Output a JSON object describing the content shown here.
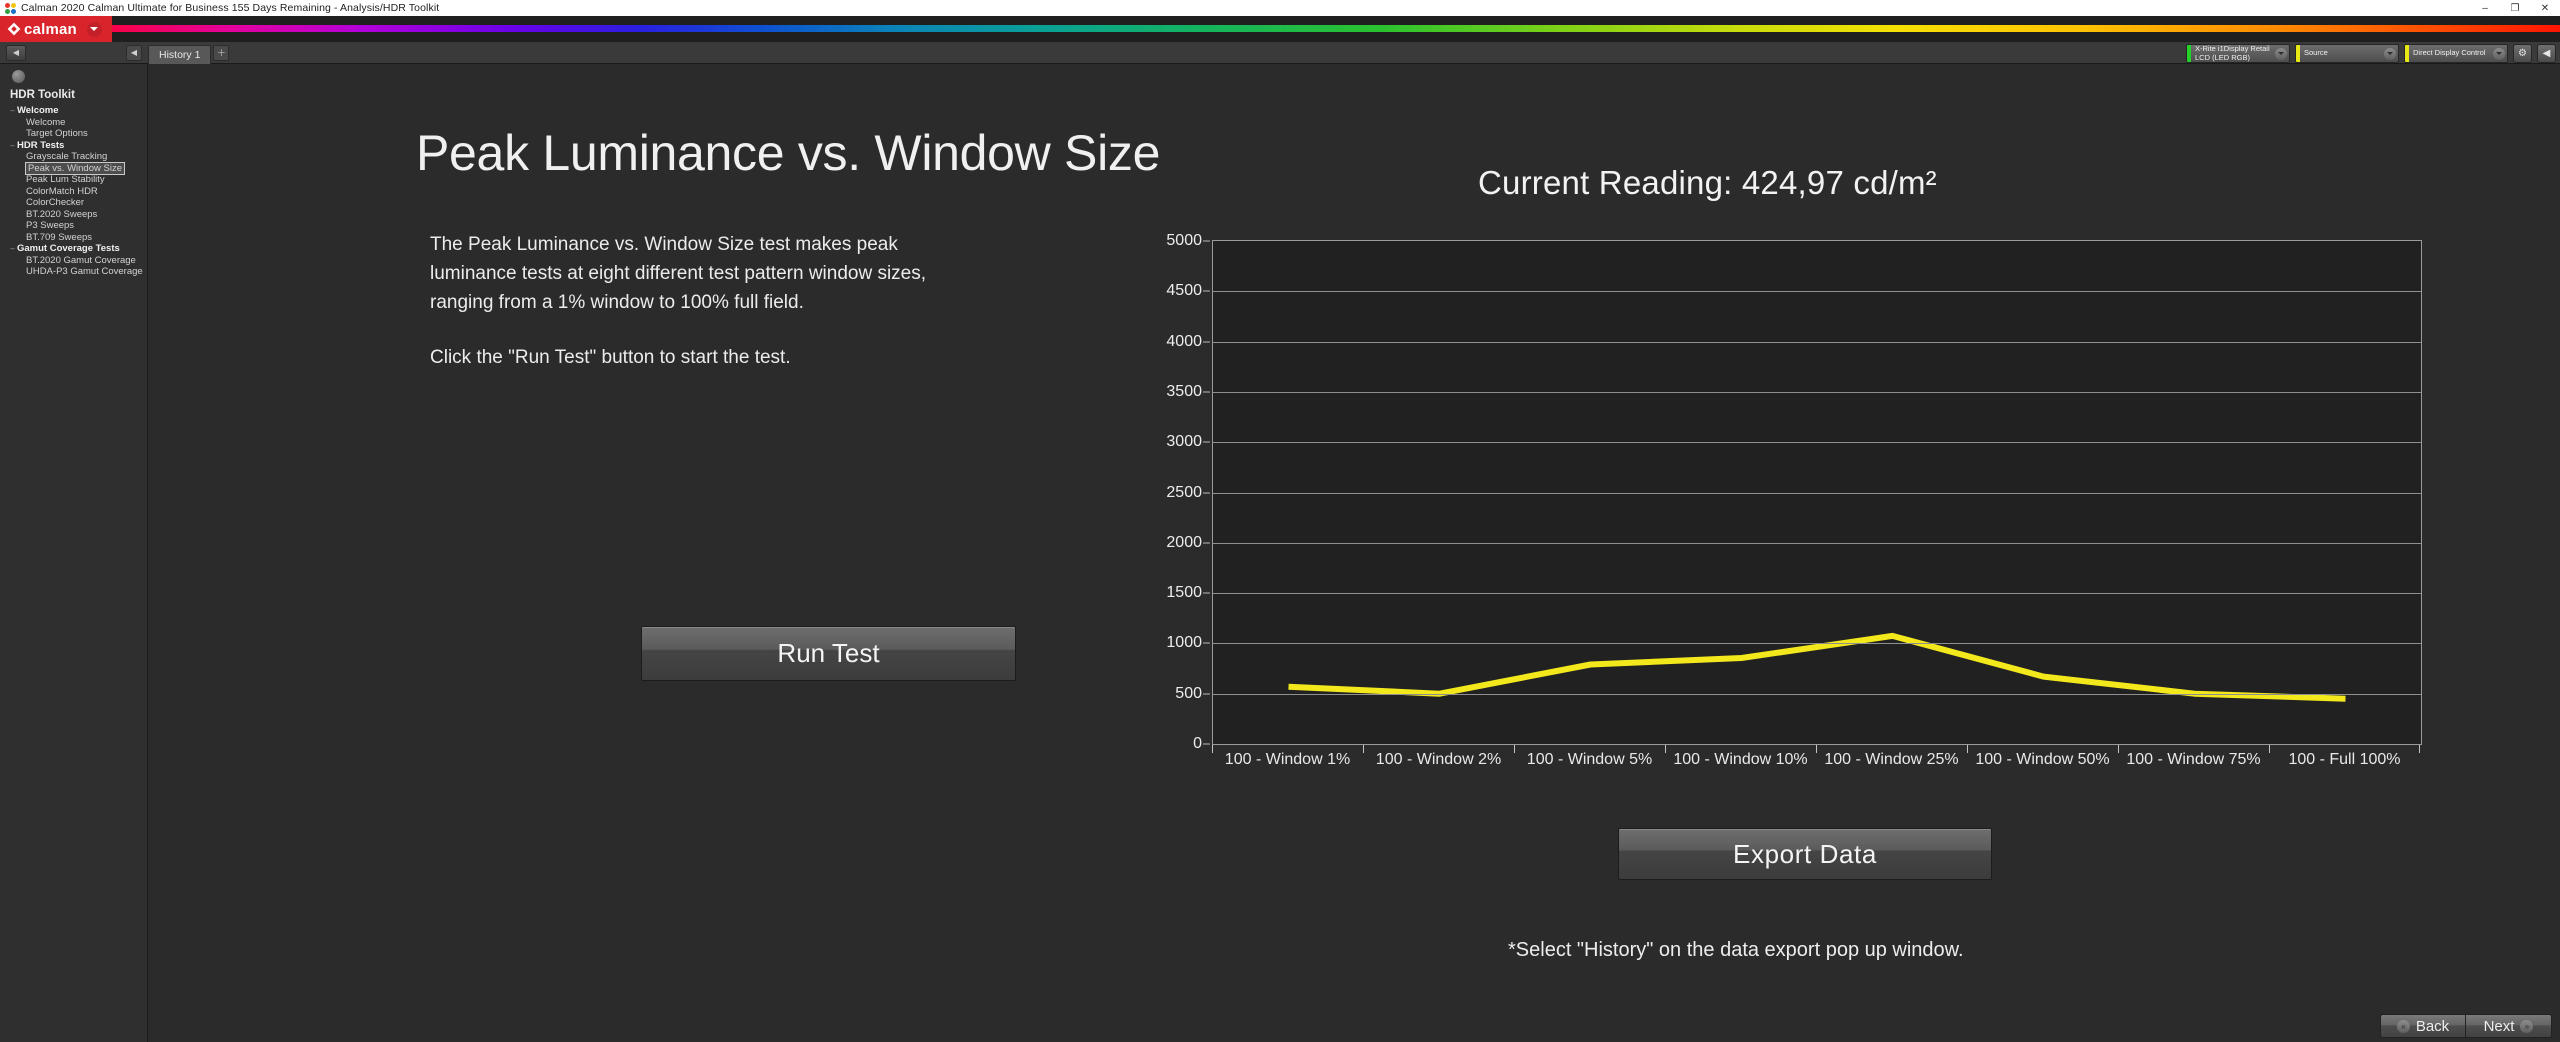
{
  "window": {
    "title": "Calman 2020 Calman Ultimate for Business 155 Days Remaining  - Analysis/HDR Toolkit",
    "minimize": "–",
    "maximize": "❐",
    "close": "✕",
    "app_icon": "calman-color-squares-icon"
  },
  "brand": {
    "name": "calman",
    "menu_caret": "▾"
  },
  "tabstrip": {
    "left_nav_icon": "◀",
    "collapse_icon": "◀",
    "tabs": [
      {
        "label": "History 1"
      }
    ],
    "add_tab_icon": "＋",
    "controls": [
      {
        "name": "meter-selector",
        "text": "X-Rite i1Display Retail\nLCD (LED RGB)",
        "status_color": "#25d126"
      },
      {
        "name": "source-selector",
        "text": "Source",
        "status_color": "#e8e815"
      },
      {
        "name": "display-control-selector",
        "text": "Direct Display Control",
        "status_color": "#e8e815"
      }
    ],
    "icon_buttons": [
      {
        "name": "settings-gear-button",
        "glyph": "⚙"
      },
      {
        "name": "panel-collapse-button",
        "glyph": "◀"
      }
    ]
  },
  "sidebar": {
    "title": "HDR Toolkit",
    "tree": [
      {
        "type": "group",
        "label": "Welcome",
        "expander": "–"
      },
      {
        "type": "child",
        "label": "Welcome",
        "selected": false
      },
      {
        "type": "child",
        "label": "Target Options",
        "selected": false
      },
      {
        "type": "group",
        "label": "HDR Tests",
        "expander": "–"
      },
      {
        "type": "child",
        "label": "Grayscale Tracking",
        "selected": false
      },
      {
        "type": "child",
        "label": "Peak vs. Window Size",
        "selected": true
      },
      {
        "type": "child",
        "label": "Peak Lum Stability",
        "selected": false
      },
      {
        "type": "child",
        "label": "ColorMatch HDR",
        "selected": false
      },
      {
        "type": "child",
        "label": "ColorChecker",
        "selected": false
      },
      {
        "type": "child",
        "label": "BT.2020 Sweeps",
        "selected": false
      },
      {
        "type": "child",
        "label": "P3 Sweeps",
        "selected": false
      },
      {
        "type": "child",
        "label": "BT.709 Sweeps",
        "selected": false
      },
      {
        "type": "group",
        "label": "Gamut Coverage Tests",
        "expander": "–"
      },
      {
        "type": "child",
        "label": "BT.2020 Gamut Coverage",
        "selected": false
      },
      {
        "type": "child",
        "label": "UHDA-P3 Gamut Coverage",
        "selected": false
      }
    ]
  },
  "main": {
    "page_title": "Peak Luminance vs. Window Size",
    "description_p1": "The Peak Luminance vs. Window Size test makes peak luminance tests at eight different test pattern window sizes, ranging from a 1% window to 100% full field.",
    "description_p2": "Click the \"Run Test\" button to start the test.",
    "current_reading": "Current Reading: 424,97 cd/m²",
    "run_test_label": "Run Test",
    "export_data_label": "Export  Data",
    "note": "*Select \"History\" on the data export pop up window."
  },
  "bottom_nav": {
    "back_label": "Back",
    "next_label": "Next",
    "back_icon": "«",
    "next_icon": "»"
  },
  "chart_data": {
    "type": "line",
    "title": "",
    "xlabel": "",
    "ylabel": "",
    "ylim": [
      0,
      5000
    ],
    "ytick_step": 500,
    "yticks": [
      0,
      500,
      1000,
      1500,
      2000,
      2500,
      3000,
      3500,
      4000,
      4500,
      5000
    ],
    "grid": true,
    "legend": "none",
    "categories": [
      "100 - Window  1%",
      "100 - Window  2%",
      "100 - Window  5%",
      "100 - Window 10%",
      "100 - Window 25%",
      "100 - Window 50%",
      "100 - Window 75%",
      "100 - Full  100%"
    ],
    "series": [
      {
        "name": "Peak Luminance",
        "color": "#f2e81c",
        "values": [
          570,
          500,
          790,
          855,
          1075,
          670,
          500,
          450
        ]
      }
    ]
  }
}
